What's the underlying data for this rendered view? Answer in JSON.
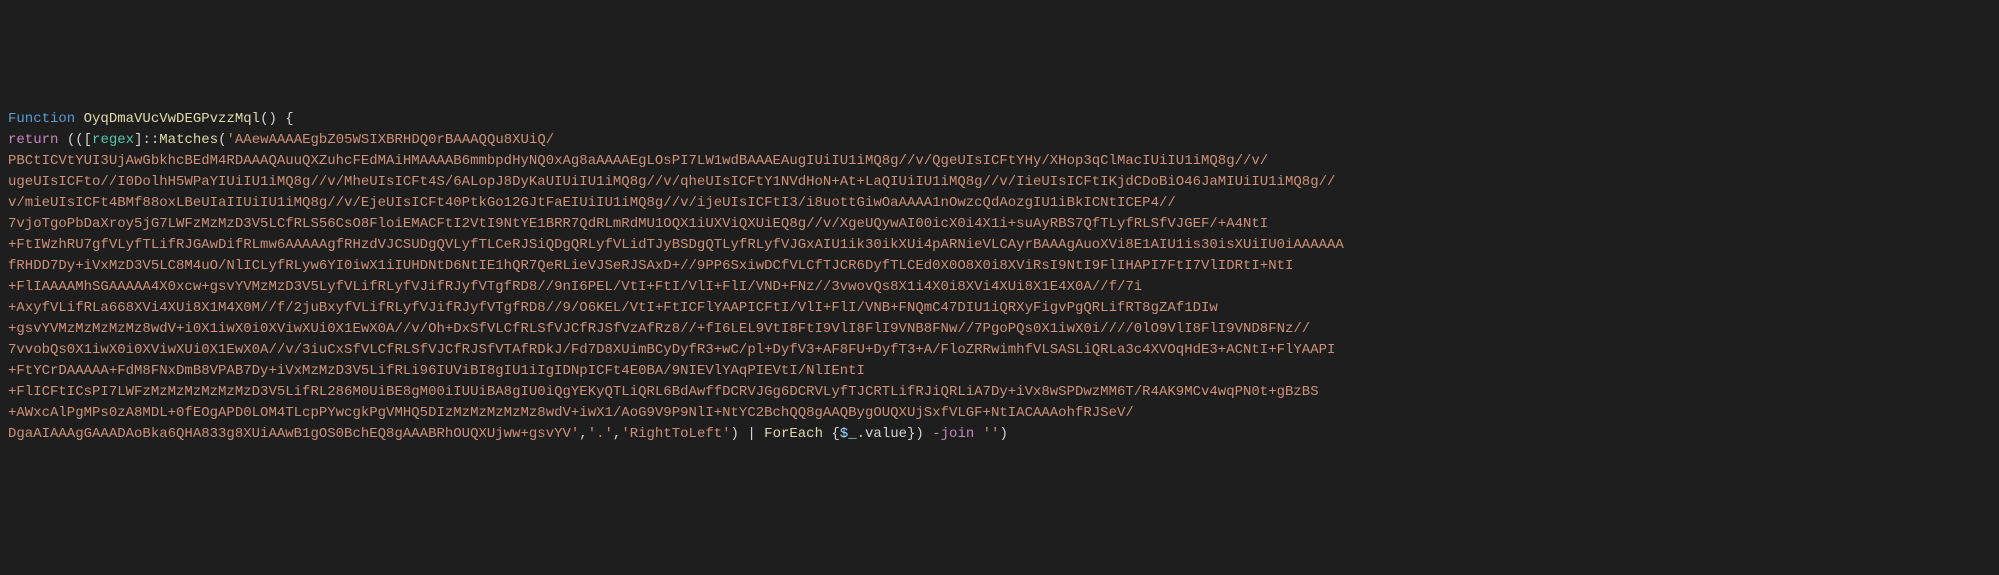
{
  "code": {
    "function_keyword": "Function",
    "function_name": "OyqDmaVUcVwDEGPvzzMql",
    "open_paren": "()",
    "open_brace": " {",
    "return_keyword": "return",
    "open_expr": " ((",
    "open_bracket": "[",
    "type_name": "regex",
    "close_bracket": "]",
    "double_colon": "::",
    "method_name": "Matches",
    "method_open": "(",
    "string_content": "'AAewAAAAEgbZ05WSIXBRHDQ0rBAAAQQu8XUiQ/\nPBCtICVtYUI3UjAwGbkhcBEdM4RDAAAQAuuQXZuhcFEdMAiHMAAAAB6mmbpdHyNQ0xAg8aAAAAEgLOsPI7LW1wdBAAAEAugIUiIU1iMQ8g//v/QgeUIsICFtYHy/XHop3qClMacIUiIU1iMQ8g//v/\nugeUIsICFto//I0DolhH5WPaYIUiIU1iMQ8g//v/MheUIsICFt4S/6ALopJ8DyKaUIUiIU1iMQ8g//v/qheUIsICFtY1NVdHoN+At+LaQIUiIU1iMQ8g//v/IieUIsICFtIKjdCDoBiO46JaMIUiIU1iMQ8g//\nv/mieUIsICFt4BMf88oxLBeUIaIIUiIU1iMQ8g//v/EjeUIsICFt40PtkGo12GJtFaEIUiIU1iMQ8g//v/ijeUIsICFtI3/i8uottGiwOaAAAA1nOwzcQdAozgIU1iBkICNtICEP4//\n7vjoTgoPbDaXroy5jG7LWFzMzMzD3V5LCfRLS56CsO8FloiEMACFtI2VtI9NtYE1BRR7QdRLmRdMU1OQX1iUXViQXUiEQ8g//v/XgeUQywAI00icX0i4X1i+suAyRBS7QfTLyfRLSfVJGEF/+A4NtI\n+FtIWzhRU7gfVLyfTLifRJGAwDifRLmw6AAAAAgfRHzdVJCSUDgQVLyfTLCeRJSiQDgQRLyfVLidTJyBSDgQTLyfRLyfVJGxAIU1ik30ikXUi4pARNieVLCAyrBAAAgAuoXVi8E1AIU1is30isXUiIU0iAAAAAA\nfRHDD7Dy+iVxMzD3V5LC8M4uO/NlICLyfRLyw6YI0iwX1iIUHDNtD6NtIE1hQR7QeRLieVJSeRJSAxD+//9PP6SxiwDCfVLCfTJCR6DyfTLCEd0X0O8X0i8XViRsI9NtI9FlIHAPI7FtI7VlIDRtI+NtI\n+FlIAAAAMhSGAAAAA4X0xcw+gsvYVMzMzD3V5LyfVLifRLyfVJifRJyfVTgfRD8//9nI6PEL/VtI+FtI/VlI+FlI/VND+FNz//3vwovQs8X1i4X0i8XVi4XUi8X1E4X0A//f/7i\n+AxyfVLifRLa668XVi4XUi8X1M4X0M//f/2juBxyfVLifRLyfVJifRJyfVTgfRD8//9/O6KEL/VtI+FtICFlYAAPICFtI/VlI+FlI/VNB+FNQmC47DIU1iQRXyFigvPgQRLifRT8gZAf1DIw\n+gsvYVMzMzMzMzMz8wdV+i0X1iwX0i0XViwXUi0X1EwX0A//v/Oh+DxSfVLCfRLSfVJCfRJSfVzAfRz8//+fI6LEL9VtI8FtI9VlI8FlI9VNB8FNw//7PgoPQs0X1iwX0i////0lO9VlI8FlI9VND8FNz//\n7vvobQs0X1iwX0i0XViwXUi0X1EwX0A//v/3iuCxSfVLCfRLSfVJCfRJSfVTAfRDkJ/Fd7D8XUimBCyDyfR3+wC/pl+DyfV3+AF8FU+DyfT3+A/FloZRRwimhfVLSASLiQRLa3c4XVOqHdE3+ACNtI+FlYAAPI\n+FtYCrDAAAAA+FdM8FNxDmB8VPAB7Dy+iVxMzMzD3V5LifRLi96IUViBI8gIU1iIgIDNpICFt4E0BA/9NIEVlYAqPIEVtI/NlIEntI\n+FlICFtICsPI7LWFzMzMzMzMzMzMzD3V5LifRL286M0UiBE8gM00iIUUiBA8gIU0iQgYEKyQTLiQRL6BdAwffDCRVJGg6DCRVLyfTJCRTLifRJiQRLiA7Dy+iVx8wSPDwzMM6T/R4AK9MCv4wqPN0t+gBzBS\n+AWxcAlPgMPs0zA8MDL+0fEOgAPD0LOM4TLcpPYwcgkPgVMHQ5DIzMzMzMzMzMz8wdV+iwX1/AoG9V9P9NlI+NtYC2BchQQ8gAAQBygOUQXUjSxfVLGF+NtIACAAAohfRJSeV/\nDgaAIAAAgGAAADAoBka6QHA833g8XUiAAwB1gOS0BchEQ8gAAABRhOUQXUjww+gsvYV'",
    "comma1": ",",
    "dot_string": "'.'",
    "comma2": ",",
    "rtl_string": "'RightToLeft'",
    "method_close": ")",
    "pipe": " | ",
    "foreach_cmdlet": "ForEach",
    "foreach_open": " {",
    "variable": "$_",
    "dot_value": ".value",
    "foreach_close": "})",
    "join_keyword": " -join ",
    "empty_string": "''",
    "close_expr": ")"
  }
}
